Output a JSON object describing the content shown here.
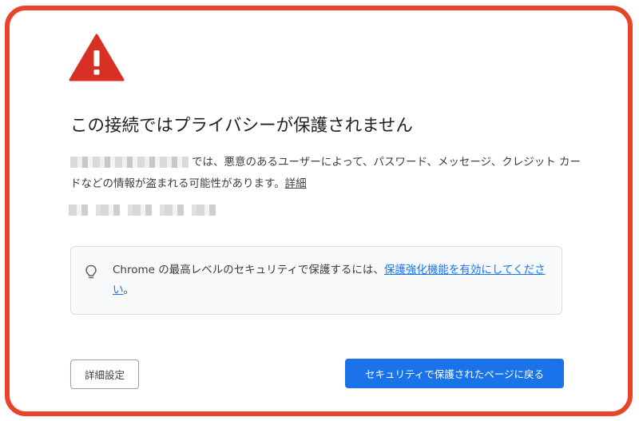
{
  "page": {
    "title": "この接続ではプライバシーが保護されません",
    "description_text": "では、悪意のあるユーザーによって、パスワード、メッセージ、クレジット カードなどの情報が盗まれる可能性があります。",
    "details_link": "詳細"
  },
  "info_box": {
    "text_prefix": "Chrome の最高レベルのセキュリティで保護するには、",
    "link_text": "保護強化機能を有効にしてください",
    "text_suffix": "。",
    "icon": "lightbulb-icon"
  },
  "buttons": {
    "advanced_label": "詳細設定",
    "back_label": "セキュリティで保護されたページに戻る"
  },
  "icons": {
    "warning": "warning-triangle-icon"
  },
  "colors": {
    "frame": "#e8442b",
    "warning": "#d93025",
    "primary_button": "#1a73e8",
    "link": "#1a73e8"
  }
}
